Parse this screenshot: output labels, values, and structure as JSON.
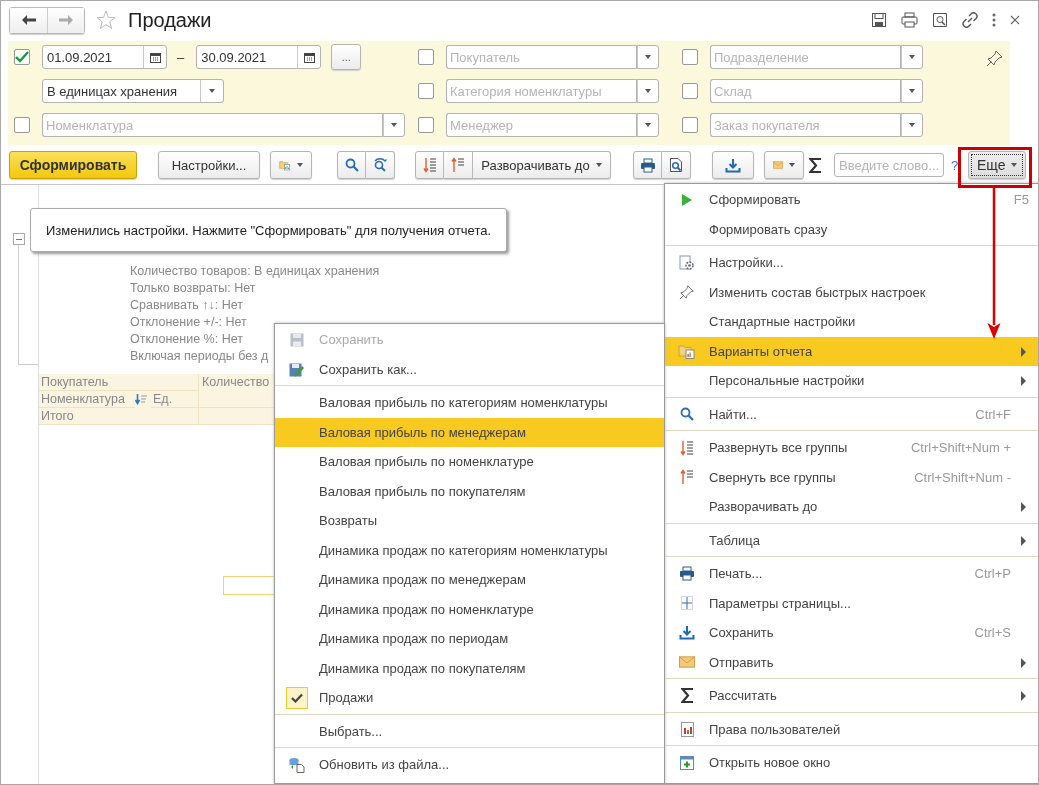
{
  "window": {
    "title": "Продажи"
  },
  "filters": {
    "period": {
      "enabled": true,
      "from": "01.09.2021",
      "separator": "–",
      "to": "30.09.2021",
      "choose": "..."
    },
    "units": {
      "value": "В единицах хранения"
    },
    "nomenclature": {
      "enabled": false,
      "placeholder": "Номенклатура"
    },
    "fields": [
      {
        "enabled": false,
        "placeholder": "Покупатель"
      },
      {
        "enabled": false,
        "placeholder": "Категория номенклатуры"
      },
      {
        "enabled": false,
        "placeholder": "Менеджер"
      },
      {
        "enabled": false,
        "placeholder": "Подразделение"
      },
      {
        "enabled": false,
        "placeholder": "Склад"
      },
      {
        "enabled": false,
        "placeholder": "Заказ покупателя"
      }
    ]
  },
  "toolbar": {
    "generate": "Сформировать",
    "settings": "Настройки...",
    "expand_to": "Разворачивать до",
    "search": {
      "placeholder": "Введите слово..."
    },
    "help": "?",
    "more": "Еще"
  },
  "notice": "Изменились настройки. Нажмите \"Сформировать\" для получения отчета.",
  "report": {
    "parameters": [
      "Количество товаров: В единицах хранения",
      "Только возвраты: Нет",
      "Сравнивать ↑↓: Нет",
      "Отклонение +/-: Нет",
      "Отклонение %: Нет",
      "Включая периоды без д"
    ],
    "table": {
      "column_1": "Покупатель",
      "column_2": "Количество",
      "sub_1": "Номенклатура",
      "sub_2": "Ед.",
      "total": "Итого"
    }
  },
  "more_menu": {
    "groups": [
      [
        {
          "label": "Сформировать",
          "shortcut": "F5",
          "submenu": false,
          "selected": false
        },
        {
          "label": "Формировать сразу",
          "submenu": false,
          "selected": false
        }
      ],
      [
        {
          "label": "Настройки...",
          "submenu": false,
          "selected": false
        },
        {
          "label": "Изменить состав быстрых настроек",
          "submenu": false,
          "selected": false
        },
        {
          "label": "Стандартные настройки",
          "submenu": false,
          "selected": false
        },
        {
          "label": "Варианты отчета",
          "submenu": true,
          "selected": true
        },
        {
          "label": "Персональные настройки",
          "submenu": true,
          "selected": false
        }
      ],
      [
        {
          "label": "Найти...",
          "shortcut": "Ctrl+F",
          "submenu": false,
          "selected": false
        }
      ],
      [
        {
          "label": "Развернуть все группы",
          "shortcut": "Ctrl+Shift+Num +",
          "submenu": false,
          "selected": false
        },
        {
          "label": "Свернуть все группы",
          "shortcut": "Ctrl+Shift+Num -",
          "submenu": false,
          "selected": false
        },
        {
          "label": "Разворачивать до",
          "submenu": true,
          "selected": false
        }
      ],
      [
        {
          "label": "Таблица",
          "submenu": true,
          "selected": false
        }
      ],
      [
        {
          "label": "Печать...",
          "shortcut": "Ctrl+P",
          "submenu": false,
          "selected": false
        },
        {
          "label": "Параметры страницы...",
          "submenu": false,
          "selected": false
        },
        {
          "label": "Сохранить",
          "shortcut": "Ctrl+S",
          "submenu": false,
          "selected": false
        },
        {
          "label": "Отправить",
          "submenu": true,
          "selected": false
        }
      ],
      [
        {
          "label": "Рассчитать",
          "submenu": true,
          "selected": false
        }
      ],
      [
        {
          "label": "Права пользователей",
          "submenu": false,
          "selected": false
        }
      ],
      [
        {
          "label": "Открыть новое окно",
          "submenu": false,
          "selected": false
        }
      ]
    ]
  },
  "variants_menu": {
    "groups": [
      [
        {
          "label": "Сохранить",
          "disabled": true,
          "checked": false,
          "selected": false
        },
        {
          "label": "Сохранить как...",
          "disabled": false,
          "checked": false,
          "selected": false
        }
      ],
      [
        {
          "label": "Валовая прибыль по категориям номенклатуры",
          "disabled": false,
          "checked": false,
          "selected": false
        },
        {
          "label": "Валовая прибыль по менеджерам",
          "disabled": false,
          "checked": false,
          "selected": true
        },
        {
          "label": "Валовая прибыль по номенклатуре",
          "disabled": false,
          "checked": false,
          "selected": false
        },
        {
          "label": "Валовая прибыль по покупателям",
          "disabled": false,
          "checked": false,
          "selected": false
        },
        {
          "label": "Возвраты",
          "disabled": false,
          "checked": false,
          "selected": false
        },
        {
          "label": "Динамика продаж по категориям номенклатуры",
          "disabled": false,
          "checked": false,
          "selected": false
        },
        {
          "label": "Динамика продаж по менеджерам",
          "disabled": false,
          "checked": false,
          "selected": false
        },
        {
          "label": "Динамика продаж по номенклатуре",
          "disabled": false,
          "checked": false,
          "selected": false
        },
        {
          "label": "Динамика продаж по периодам",
          "disabled": false,
          "checked": false,
          "selected": false
        },
        {
          "label": "Динамика продаж по покупателям",
          "disabled": false,
          "checked": false,
          "selected": false
        },
        {
          "label": "Продажи",
          "disabled": false,
          "checked": true,
          "selected": false
        }
      ],
      [
        {
          "label": "Выбрать...",
          "disabled": false,
          "checked": false,
          "selected": false
        }
      ],
      [
        {
          "label": "Обновить из файла...",
          "disabled": false,
          "checked": false,
          "selected": false
        }
      ]
    ]
  }
}
